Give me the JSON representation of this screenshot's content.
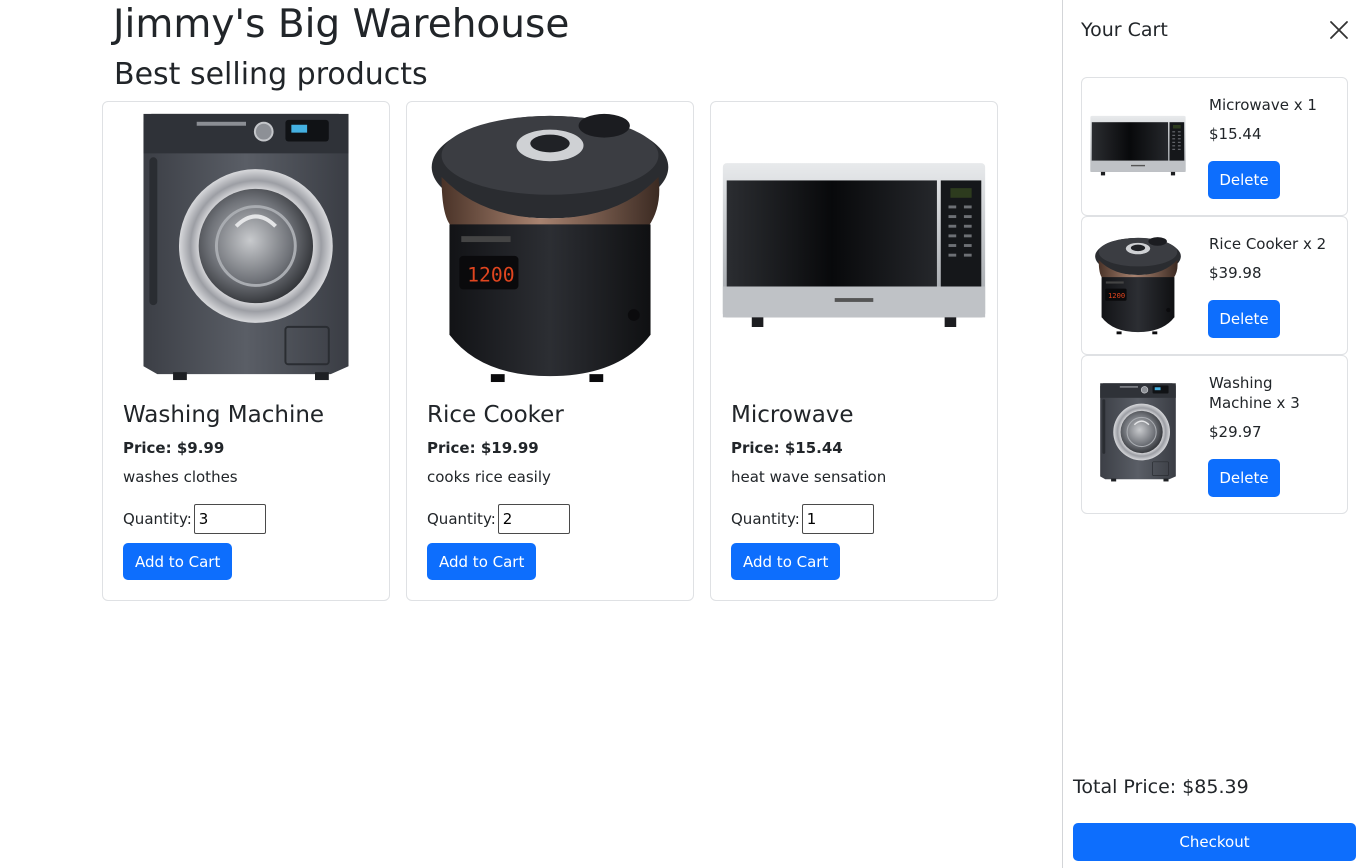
{
  "site": {
    "title": "Jimmy's Big Warehouse",
    "section_title": "Best selling products"
  },
  "products": [
    {
      "name": "Washing Machine",
      "price": "Price: $9.99",
      "description": "washes clothes",
      "quantity_label": "Quantity:",
      "quantity": "3",
      "button": "Add to Cart",
      "image": "washing-machine-image"
    },
    {
      "name": "Rice Cooker",
      "price": "Price: $19.99",
      "description": "cooks rice easily",
      "quantity_label": "Quantity:",
      "quantity": "2",
      "button": "Add to Cart",
      "image": "rice-cooker-image"
    },
    {
      "name": "Microwave",
      "price": "Price: $15.44",
      "description": "heat wave sensation",
      "quantity_label": "Quantity:",
      "quantity": "1",
      "button": "Add to Cart",
      "image": "microwave-image"
    }
  ],
  "cart": {
    "title": "Your Cart",
    "close_icon": "close-icon",
    "items": [
      {
        "name": "Microwave x 1",
        "price": "$15.44",
        "button": "Delete",
        "image": "microwave-image"
      },
      {
        "name": "Rice Cooker x 2",
        "price": "$39.98",
        "button": "Delete",
        "image": "rice-cooker-image"
      },
      {
        "name": "Washing Machine x 3",
        "price": "$29.97",
        "button": "Delete",
        "image": "washing-machine-image"
      }
    ],
    "total": "Total Price: $85.39",
    "checkout": "Checkout"
  },
  "colors": {
    "primary": "#0d6efd",
    "border": "#dfe1e4",
    "text": "#212529"
  }
}
